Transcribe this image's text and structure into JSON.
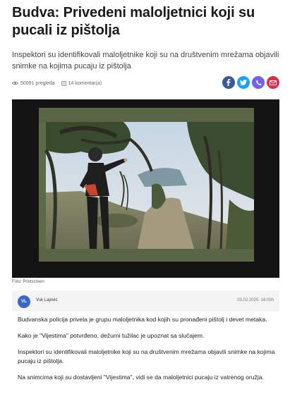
{
  "article": {
    "title": "Budva: Privedeni maloljetnici koji su pucali iz pištolja",
    "lead": "Inspektori su identifikovali maloljetnike koji su na društvenim mrežama objavili snimke na kojima pucaju iz pištolja",
    "views": "50091 pregleda",
    "comments": "14 komentar(a)",
    "photo_caption": "Foto: Printscreen",
    "author_initials": "VL",
    "author": "Vuk Lajović",
    "date": "03.02.2025. 16:00h",
    "paragraphs": [
      "Budvanska policija privela je grupu maloljetnika kod kojih su pronađeni pištolj i devet metaka.",
      "Kako je \"Vijestima\" potvrđeno, dežurni tužilac je upoznat sa slučajem.",
      "Inspektori su identifikovali maloljetnike koji su na društvenim mrežama objavili snimke na kojima pucaju iz pištolja.",
      "Na snimcima koji su dostavljeni \"Vijestima\", vidi se da maloljetnici pucaju iz vatrenog oružja."
    ]
  },
  "share": [
    {
      "icon": "facebook-icon",
      "color": "#3b5998"
    },
    {
      "icon": "twitter-icon",
      "color": "#1da1f2"
    },
    {
      "icon": "viber-icon",
      "color": "#7360f2"
    },
    {
      "icon": "email-icon",
      "color": "#d9304f"
    }
  ],
  "colors": {
    "avatar": "#3b66c4",
    "byline_bg": "#f4f4f4",
    "photo_frame": "#141414"
  }
}
